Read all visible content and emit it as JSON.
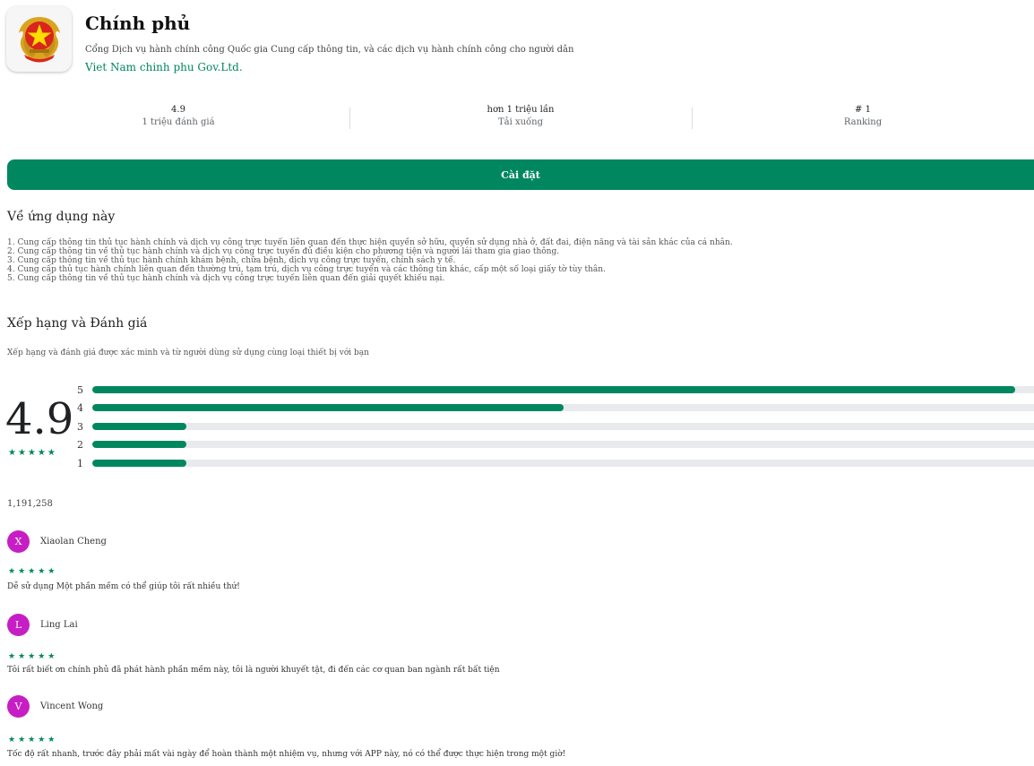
{
  "app": {
    "title": "Chính phủ",
    "description": "Cổng Dịch vụ hành chính công Quốc gia Cung cấp thông tin, và các dịch vụ hành chính công cho người dân",
    "developer": "Viet Nam chinh phu Gov.Ltd."
  },
  "stats": [
    {
      "value": "4.9",
      "label": "1 triệu đánh giá"
    },
    {
      "value": "hơn 1 triệu lần",
      "label": "Tải xuống"
    },
    {
      "value": "# 1",
      "label": "Ranking"
    }
  ],
  "install_label": "Cài đặt",
  "about": {
    "title": "Về ứng dụng này",
    "lines": [
      "1. Cung cấp thông tin thủ tục hành chính và dịch vụ công trực tuyến liên quan đến thực hiện quyền sở hữu, quyền sử dụng nhà ở, đất đai, điện năng và tài sản khác của cá nhân.",
      "2. Cung cấp thông tin về thủ tục hành chính và dịch vụ công trực tuyến đủ điều kiện cho phương tiện và người lái tham gia giao thông.",
      "3. Cung cấp thông tin về thủ tục hành chính khám bệnh, chữa bệnh, dịch vụ công trực tuyến, chính sách y tế.",
      "4. Cung cấp thủ tục hành chính liên quan đến thường trú, tạm trú, dịch vụ công trực tuyến và các thông tin khác, cấp một số loại giấy tờ tùy thân.",
      "5. Cung cấp thông tin về thủ tục hành chính và dịch vụ công trực tuyến liên quan đến giải quyết khiếu nại."
    ]
  },
  "ratings": {
    "title": "Xếp hạng và Đánh giá",
    "subtitle": "Xếp hạng và đánh giá được xác minh và từ người dùng sử dụng cùng loại thiết bị với bạn",
    "score": "4.9",
    "score_stars": "★★★★★",
    "total": "1,191,258",
    "bars": [
      {
        "label": "5",
        "fraction": 0.98
      },
      {
        "label": "4",
        "fraction": 0.5
      },
      {
        "label": "3",
        "fraction": 0.1
      },
      {
        "label": "2",
        "fraction": 0.1
      },
      {
        "label": "1",
        "fraction": 0.1
      }
    ]
  },
  "reviews": [
    {
      "initial": "X",
      "name": "Xiaolan Cheng",
      "stars": "★★★★★",
      "text": "Dễ sử dụng Một phần mềm có thể giúp tôi rất nhiều thứ!"
    },
    {
      "initial": "L",
      "name": "Ling Lai",
      "stars": "★★★★★",
      "text": "Tôi rất biết ơn chính phủ đã phát hành phần mềm này, tôi là người khuyết tật, đi đến các cơ quan ban ngành rất bất tiện"
    },
    {
      "initial": "V",
      "name": "Vincent Wong",
      "stars": "★★★★★",
      "text": "Tốc độ rất nhanh, trước đây phải mất vài ngày để hoàn thành một nhiệm vụ, nhưng với APP này, nó có thể được thực hiện trong một giờ!"
    }
  ],
  "colors": {
    "accent": "#01875f",
    "avatar": "#c61ec4",
    "bar_track": "#e8eaed"
  },
  "icons": {
    "app_icon": "vietnam-emblem-icon"
  }
}
